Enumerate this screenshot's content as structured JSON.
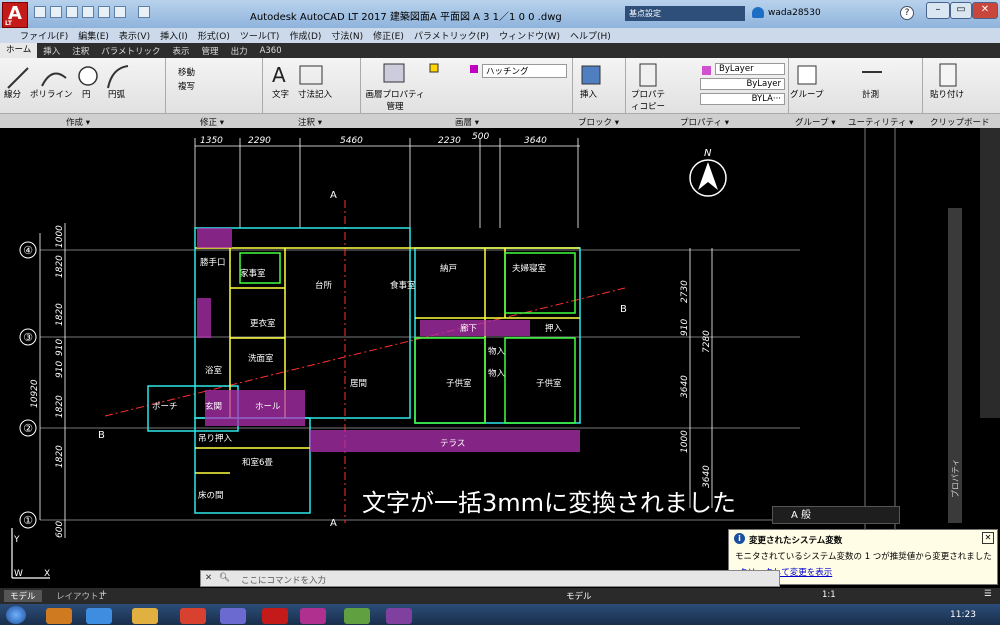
{
  "app": {
    "logo_text": "A",
    "logo_sub": "LT",
    "window_title": "Autodesk AutoCAD LT 2017   建築図面A  平面図  A 3  1／1 0 0 .dwg",
    "search_label": "基点設定",
    "user": "wada28530"
  },
  "menu": [
    "ファイル(F)",
    "編集(E)",
    "表示(V)",
    "挿入(I)",
    "形式(O)",
    "ツール(T)",
    "作成(D)",
    "寸法(N)",
    "修正(E)",
    "パラメトリック(P)",
    "ウィンドウ(W)",
    "ヘルプ(H)"
  ],
  "tabs": [
    "ホーム",
    "挿入",
    "注釈",
    "パラメトリック",
    "表示",
    "管理",
    "出力",
    "A360"
  ],
  "ribbon": {
    "line": "線分",
    "polyline": "ポリライン",
    "circle": "円",
    "arc": "円弧",
    "move": "移動",
    "copy": "複写",
    "text": "文字",
    "dimension": "寸法記入",
    "layer_props": "画層プロパティ管理",
    "hatch": "ハッチング",
    "insert": "挿入",
    "prop_copy": "プロパティコピー",
    "bylayer1": "ByLayer",
    "bylayer2": "ByLayer",
    "bylayer3": "BYLA···",
    "group": "グループ",
    "measure": "計測",
    "paste": "貼り付け"
  },
  "panels": [
    "作成 ▾",
    "修正 ▾",
    "注釈 ▾",
    "画層 ▾",
    "ブロック ▾",
    "プロパティ ▾",
    "グループ ▾",
    "ユーティリティ ▾",
    "クリップボード"
  ],
  "drawing": {
    "dims_top": [
      "1350",
      "2290",
      "5460",
      "2230",
      "500",
      "3640"
    ],
    "dims_left": [
      "1000",
      "1820",
      "1820",
      "910",
      "910",
      "1820",
      "1820",
      "600"
    ],
    "dim_total_left": "10920",
    "dims_right": [
      "2730",
      "910",
      "3640",
      "1000",
      "7280",
      "3640"
    ],
    "grid_labels": [
      "④",
      "③",
      "②",
      "①"
    ],
    "section_A": "A",
    "section_B": "B",
    "north": "N",
    "rooms": {
      "r1": "勝手口",
      "r2": "家事室",
      "r3": "台所",
      "r4": "食事室",
      "r5": "納戸",
      "r6": "夫婦寝室",
      "r7": "更衣室",
      "r8": "洗面室",
      "r9": "浴室",
      "r10": "居間",
      "r11": "廊下",
      "r12": "押入",
      "r13": "物入",
      "r14": "物入",
      "r15": "子供室",
      "r16": "子供室",
      "r17": "ポーチ",
      "r18": "玄関",
      "r19": "ホール",
      "r20": "吊り押入",
      "r21": "和室6畳",
      "r22": "床の間",
      "r23": "テラス"
    },
    "message": "文字が一括3mmに変換されました"
  },
  "palette_label": "A 般",
  "properties_label": "プロパティ",
  "notice": {
    "title": "変更されたシステム変数",
    "body": "モニタされているシステム変数の 1 つが推奨値から変更されました",
    "link": "クリックして変更を表示"
  },
  "cmdline": {
    "placeholder": "ここにコマンドを入力"
  },
  "status": {
    "model_tab": "モデル",
    "layout_tab": "レイアウト1",
    "add": "+",
    "model_btn": "モデル",
    "scale": "1:1"
  },
  "taskbar": {
    "clock": "11:23"
  }
}
